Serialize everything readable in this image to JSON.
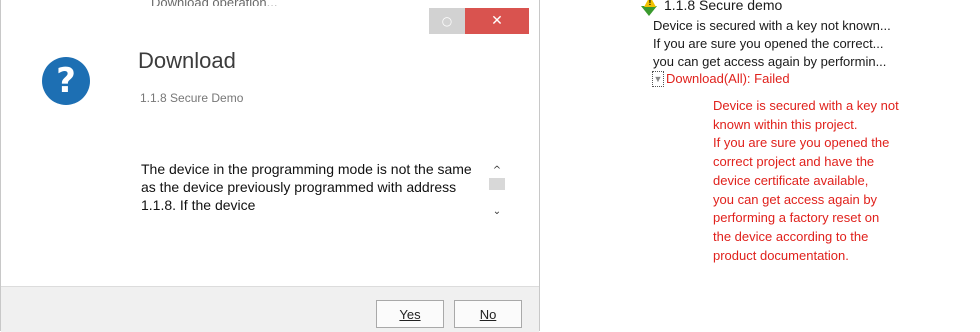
{
  "dialog": {
    "top_clip_text": "Download operation...",
    "minimize_glyph": "○",
    "close_glyph": "✕",
    "help_glyph": "?",
    "title": "Download",
    "subtitle": "1.1.8 Secure Demo",
    "message": "The device in the programming mode is not the same as the device previously programmed with address 1.1.8. If the device",
    "scroll_up_glyph": "^",
    "scroll_down_glyph": "⌄",
    "yes_label": "Yes",
    "no_label": "No"
  },
  "panel": {
    "title": "1.1.8 Secure demo",
    "lines": [
      "Device is secured with a key not known...",
      "If you are sure you opened the correct...",
      "you can get access again by performin..."
    ],
    "expander_glyph": "▼",
    "status": "Download(All): Failed",
    "detail_lines": [
      "Device is secured with a key not",
      "known within this project.",
      "If you are sure you opened the",
      "correct project and have the",
      "device certificate available,",
      "you can get access again by",
      "performing a factory reset on",
      "the device according to the",
      "product documentation."
    ],
    "warn_glyph": "!"
  },
  "colors": {
    "close_button": "#d9534f",
    "help_icon": "#1d6fb3",
    "error_text": "#e0211c",
    "warning": "#f2c200",
    "download_arrow": "#3a9a2e"
  }
}
